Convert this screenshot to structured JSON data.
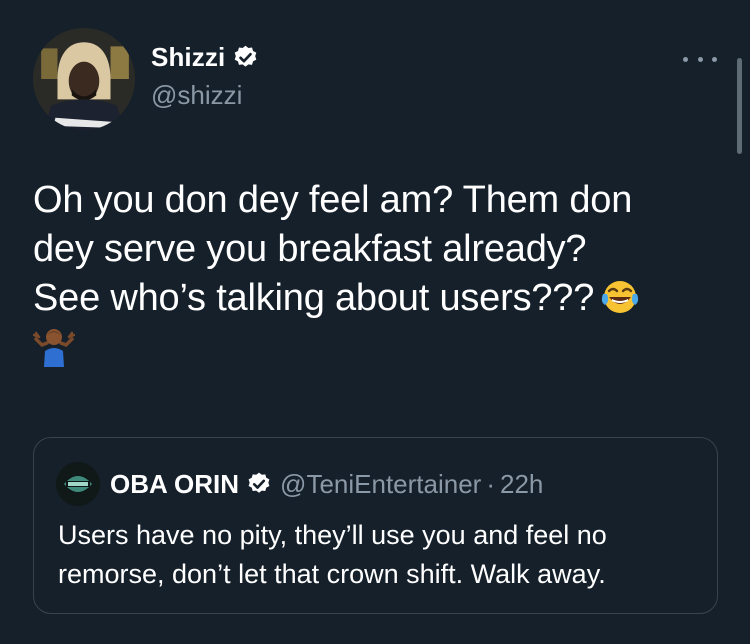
{
  "author": {
    "display_name": "Shizzi",
    "handle": "@shizzi",
    "verified": true
  },
  "menu": {
    "icon": "more-horizontal-icon"
  },
  "tweet": {
    "lines": [
      "Oh you don dey feel am? Them don",
      "dey serve you breakfast already?",
      "See who’s talking about users???"
    ],
    "emojis": [
      "face-with-tears-of-joy",
      "person-shrugging"
    ]
  },
  "quoted_tweet": {
    "display_name": "OBA ORIN",
    "handle": "@TeniEntertainer",
    "separator": "·",
    "time": "22h",
    "verified": true,
    "text_lines": [
      "Users have no pity, they’ll use you and feel no",
      "remorse, don’t let that crown shift. Walk away."
    ]
  },
  "colors": {
    "background": "#15202b",
    "text_primary": "#ffffff",
    "text_secondary": "#8b98a5",
    "border": "#38444d"
  }
}
